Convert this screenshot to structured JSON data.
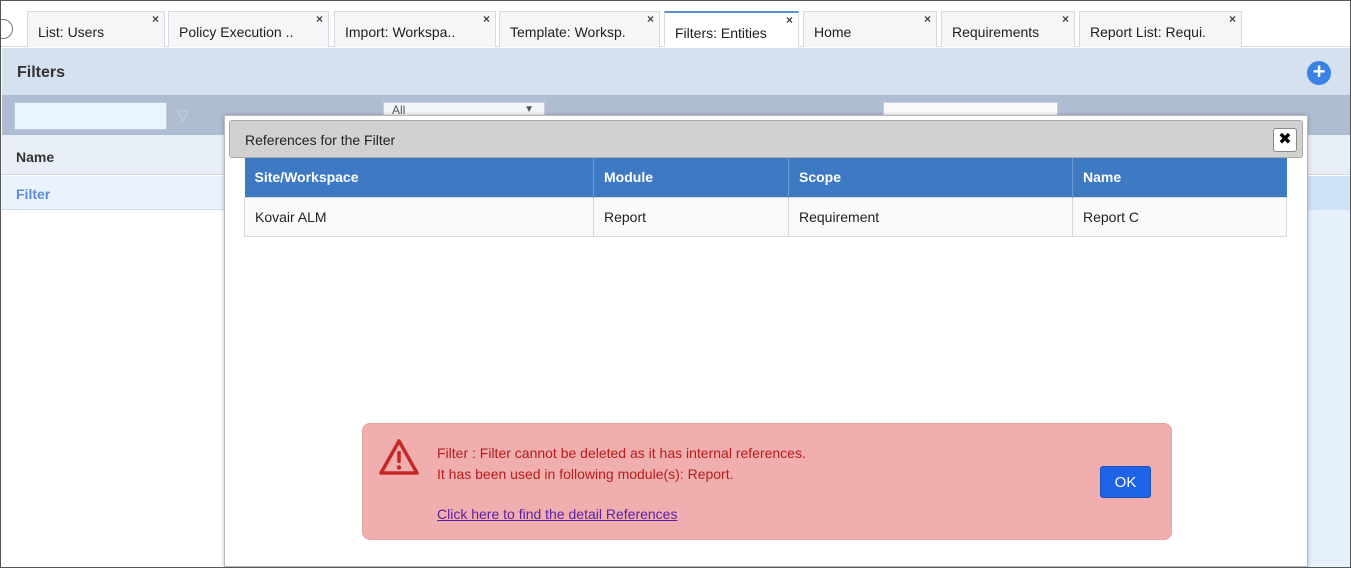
{
  "tabs": [
    {
      "label": "List: Users"
    },
    {
      "label": "Policy Execution .."
    },
    {
      "label": "Import: Workspa.."
    },
    {
      "label": "Template: Worksp."
    },
    {
      "label": "Filters: Entities"
    },
    {
      "label": "Home"
    },
    {
      "label": "Requirements"
    },
    {
      "label": "Report List: Requi."
    }
  ],
  "tab_close_glyph": "×",
  "header": {
    "title": "Filters",
    "add_icon": "plus-circle-icon"
  },
  "toolbar": {
    "select_value": "All"
  },
  "grid": {
    "column_name": "Name",
    "rows": [
      {
        "name": "Filter"
      }
    ]
  },
  "modal": {
    "title": "References for the Filter",
    "close_glyph": "✖",
    "columns": [
      "Site/Workspace",
      "Module",
      "Scope",
      "Name"
    ],
    "rows": [
      [
        "Kovair ALM",
        "Report",
        "Requirement",
        "Report C"
      ]
    ]
  },
  "alert": {
    "icon": "warning-triangle-icon",
    "line1": "Filter : Filter cannot be deleted as it has internal references.",
    "line2": "It has been used in following module(s): Report.",
    "link": "Click here to find the detail References",
    "ok_label": "OK"
  },
  "colors": {
    "accent": "#3e79c4",
    "alert_bg": "#f1aeae",
    "alert_text": "#b71c1c",
    "ok_button": "#1f63e6"
  }
}
